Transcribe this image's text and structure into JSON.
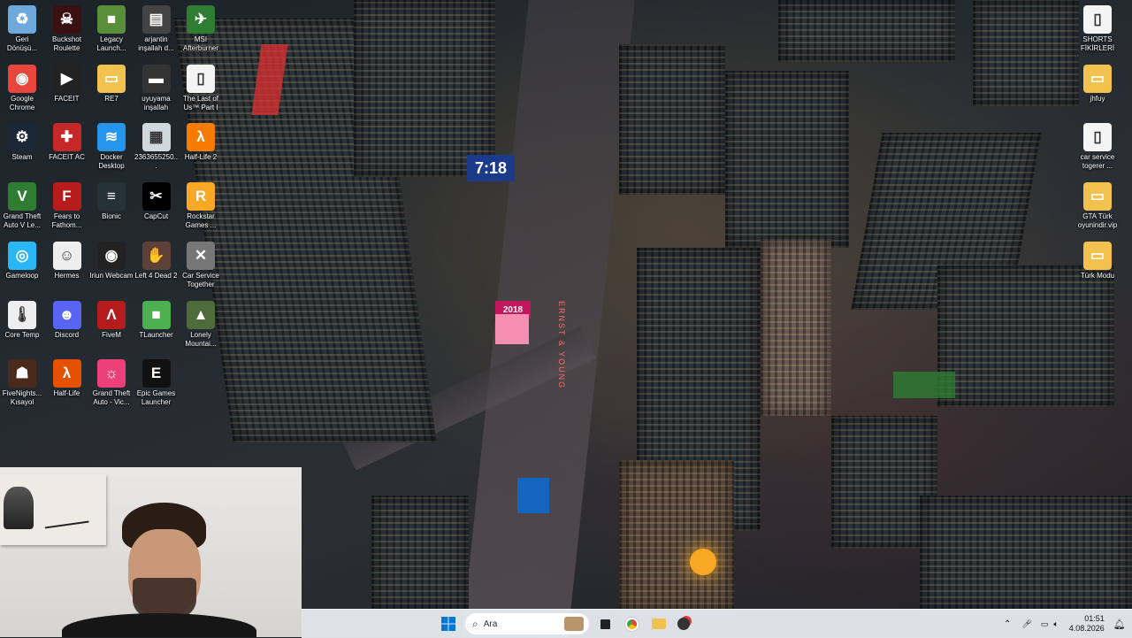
{
  "desktop": {
    "icons_left": [
      {
        "label": "Geri Dönüşü...",
        "icon": "recycle-bin-icon",
        "color": "#6fa8dc",
        "glyph": "♻"
      },
      {
        "label": "Buckshot Roulette",
        "icon": "buckshot-icon",
        "color": "#3a1010",
        "glyph": "☠"
      },
      {
        "label": "Legacy Launch...",
        "icon": "legacy-launcher-icon",
        "color": "#5a8f3a",
        "glyph": "■"
      },
      {
        "label": "arjantin inşallah d...",
        "icon": "image-file-icon",
        "color": "#444",
        "glyph": "▤"
      },
      {
        "label": "MSI Afterburner",
        "icon": "msi-afterburner-icon",
        "color": "#2e7d32",
        "glyph": "✈"
      },
      {
        "label": "Google Chrome",
        "icon": "chrome-icon",
        "color": "#e8453c",
        "glyph": "◉"
      },
      {
        "label": "FACEIT",
        "icon": "faceit-icon",
        "color": "#222",
        "glyph": "▶"
      },
      {
        "label": "RE7",
        "icon": "folder-icon",
        "color": "#f2c14e",
        "glyph": "▭"
      },
      {
        "label": "uyuyama inşallah",
        "icon": "image-file-icon",
        "color": "#333",
        "glyph": "▬"
      },
      {
        "label": "The Last of Us™ Part I",
        "icon": "document-icon",
        "color": "#f4f4f4",
        "glyph": "▯"
      },
      {
        "label": "Steam",
        "icon": "steam-icon",
        "color": "#1b2838",
        "glyph": "⚙"
      },
      {
        "label": "FACEIT AC",
        "icon": "faceit-ac-icon",
        "color": "#c62828",
        "glyph": "✚"
      },
      {
        "label": "Docker Desktop",
        "icon": "docker-icon",
        "color": "#2496ed",
        "glyph": "≋"
      },
      {
        "label": "2363655250...",
        "icon": "image-file-icon",
        "color": "#cfd8dc",
        "glyph": "▦"
      },
      {
        "label": "Half-Life 2",
        "icon": "half-life-2-icon",
        "color": "#f57c00",
        "glyph": "λ"
      },
      {
        "label": "Grand Theft Auto V Le...",
        "icon": "gta-v-icon",
        "color": "#2e7d32",
        "glyph": "V"
      },
      {
        "label": "Fears to Fathom...",
        "icon": "fears-to-fathom-icon",
        "color": "#b71c1c",
        "glyph": "F"
      },
      {
        "label": "Bionic",
        "icon": "bionic-icon",
        "color": "#263238",
        "glyph": "≡"
      },
      {
        "label": "CapCut",
        "icon": "capcut-icon",
        "color": "#000",
        "glyph": "✂"
      },
      {
        "label": "Rockstar Games ...",
        "icon": "rockstar-icon",
        "color": "#f9a825",
        "glyph": "R"
      },
      {
        "label": "Gameloop",
        "icon": "gameloop-icon",
        "color": "#29b6f6",
        "glyph": "◎"
      },
      {
        "label": "Hermes",
        "icon": "hermes-icon",
        "color": "#eee",
        "glyph": "☺"
      },
      {
        "label": "Iriun Webcam",
        "icon": "iriun-webcam-icon",
        "color": "#222",
        "glyph": "◉"
      },
      {
        "label": "Left 4 Dead 2",
        "icon": "left4dead2-icon",
        "color": "#5d4037",
        "glyph": "✋"
      },
      {
        "label": "Car Service Together",
        "icon": "car-service-icon",
        "color": "#777",
        "glyph": "✕"
      },
      {
        "label": "Core Temp",
        "icon": "core-temp-icon",
        "color": "#eee",
        "glyph": "🌡"
      },
      {
        "label": "Discord",
        "icon": "discord-icon",
        "color": "#5865f2",
        "glyph": "☻"
      },
      {
        "label": "FiveM",
        "icon": "fivem-icon",
        "color": "#b71c1c",
        "glyph": "Λ"
      },
      {
        "label": "TLauncher",
        "icon": "tlauncher-icon",
        "color": "#4caf50",
        "glyph": "■"
      },
      {
        "label": "Lonely Mountai...",
        "icon": "lonely-mountains-icon",
        "color": "#4e6b3a",
        "glyph": "▲"
      },
      {
        "label": "FiveNights... Kısayol",
        "icon": "fnaf-icon",
        "color": "#4a2a1a",
        "glyph": "☗"
      },
      {
        "label": "Half-Life",
        "icon": "half-life-icon",
        "color": "#e65100",
        "glyph": "λ"
      },
      {
        "label": "Grand Theft Auto - Vic...",
        "icon": "gta-vice-city-icon",
        "color": "#ec407a",
        "glyph": "☼"
      },
      {
        "label": "Epic Games Launcher",
        "icon": "epic-games-icon",
        "color": "#111",
        "glyph": "E"
      }
    ],
    "icons_right": [
      {
        "label": "SHORTS FİKİRLERİ",
        "icon": "document-icon",
        "color": "#f4f4f4",
        "glyph": "▯"
      },
      {
        "label": "jhfuy",
        "icon": "folder-icon",
        "color": "#f2c14e",
        "glyph": "▭"
      },
      {
        "label": "car service togerer ...",
        "icon": "document-icon",
        "color": "#f4f4f4",
        "glyph": "▯"
      },
      {
        "label": "GTA Türk oyunindir.vip",
        "icon": "folder-icon",
        "color": "#f2c14e",
        "glyph": "▭"
      },
      {
        "label": "Türk Modu",
        "icon": "folder-icon",
        "color": "#f2c14e",
        "glyph": "▭"
      }
    ],
    "billboard_time": "7:18",
    "billboard_year": "2018",
    "sign_text": "ERNST & YOUNG"
  },
  "taskbar": {
    "search_placeholder": "Ara",
    "time": "01:51",
    "date": "4.08.2026"
  }
}
